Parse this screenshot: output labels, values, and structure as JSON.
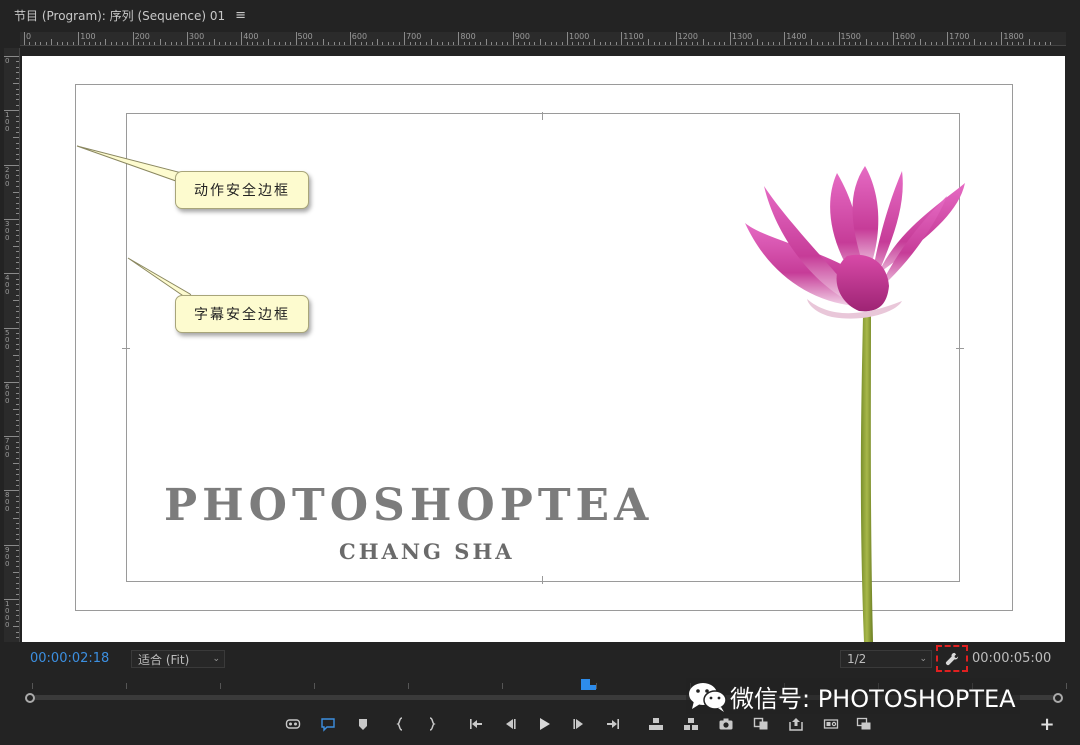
{
  "panel": {
    "title": "节目 (Program): 序列 (Sequence) 01",
    "menu_icon": "hamburger-icon"
  },
  "ruler": {
    "top_labels": [
      "0",
      "100",
      "200",
      "300",
      "400",
      "500",
      "600",
      "700",
      "800",
      "900",
      "1000",
      "1100",
      "1200",
      "1300",
      "1400",
      "1500",
      "1600",
      "1700",
      "1800"
    ],
    "left_labels": [
      "0",
      "100",
      "200",
      "300",
      "400",
      "500",
      "600",
      "700",
      "800",
      "900",
      "1000"
    ]
  },
  "preview": {
    "callout_action": "动作安全边框",
    "callout_title": "字幕安全边框",
    "watermark_main": "PHOTOSHOPTEA",
    "watermark_sub": "CHANG SHA",
    "image": "pink-lotus-flower"
  },
  "controls": {
    "current_time": "00:00:02:18",
    "zoom_value": "适合 (Fit)",
    "resolution_value": "1/2",
    "duration": "00:00:05:00",
    "settings_icon": "wrench-icon",
    "accent_color": "#2d8ceb",
    "highlight_color": "#e02020"
  },
  "overlay": {
    "wechat_text": "微信号: PHOTOSHOPTEA"
  },
  "transport": {
    "buttons": [
      "vr-video-icon",
      "comment-marker-icon",
      "add-marker-icon",
      "mark-in-icon",
      "mark-out-icon",
      "go-to-in-icon",
      "step-back-icon",
      "play-icon",
      "step-forward-icon",
      "go-to-out-icon",
      "lift-icon",
      "extract-icon",
      "export-frame-icon",
      "comparison-view-icon",
      "overwrite-icon",
      "proxy-toggle-icon",
      "multi-camera-icon",
      "button-editor-plus-icon"
    ]
  }
}
